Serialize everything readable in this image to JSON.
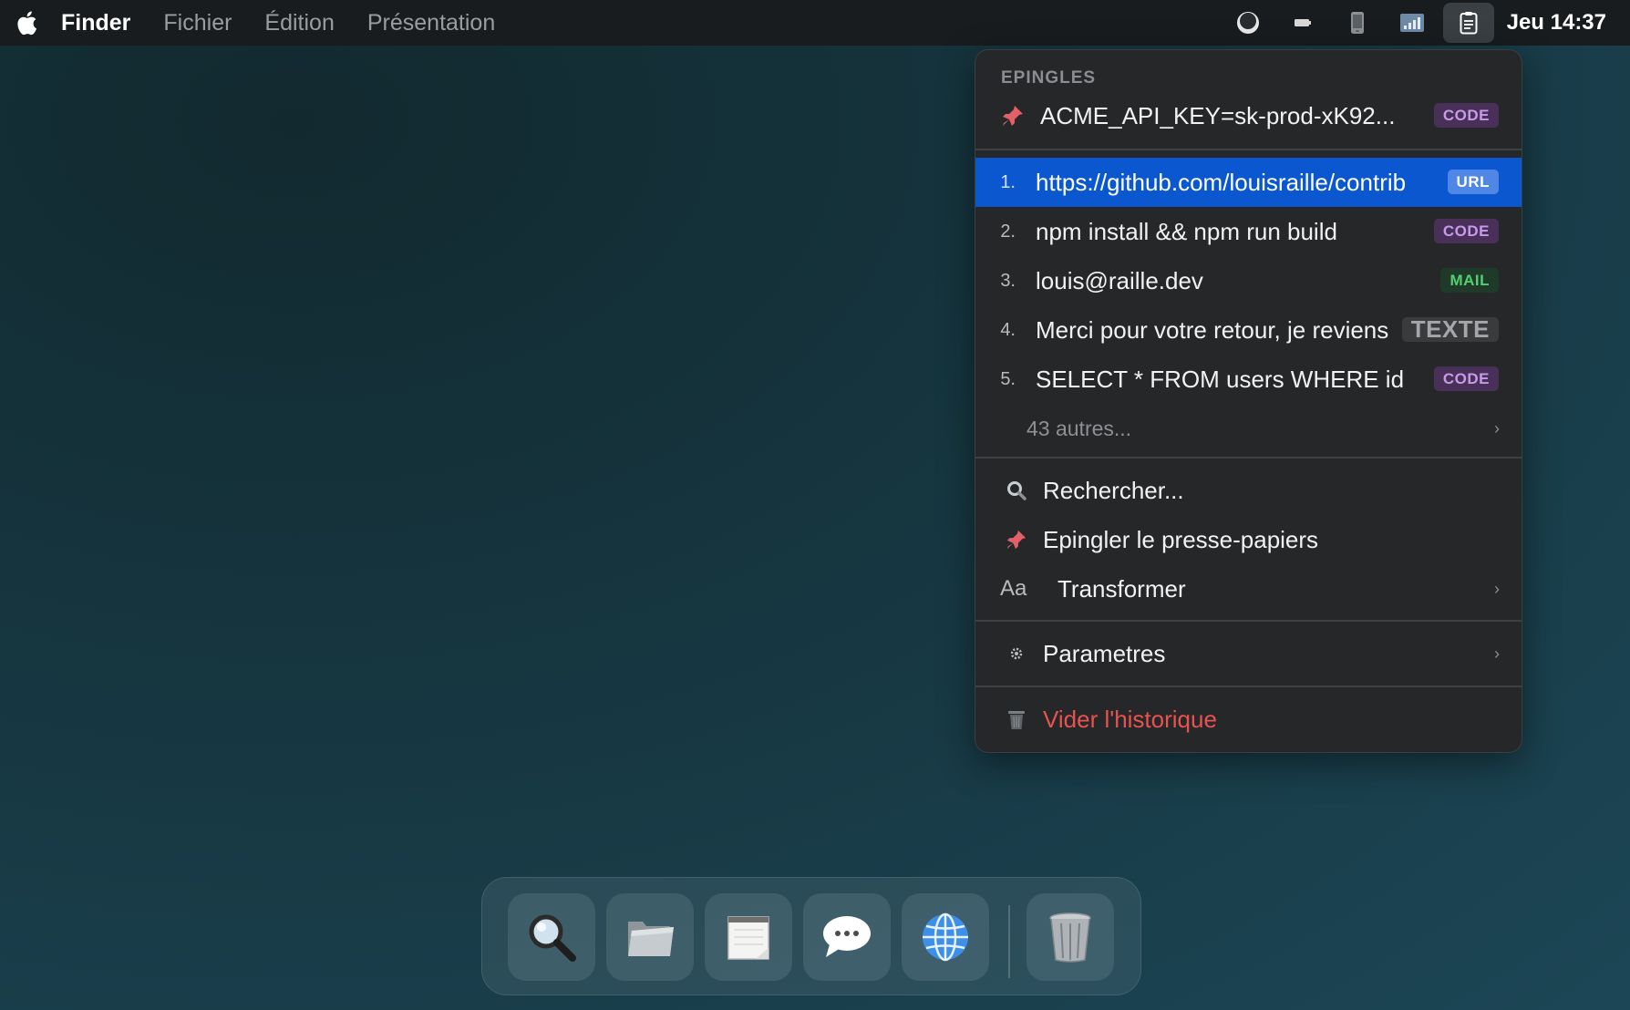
{
  "menubar": {
    "app_name": "Finder",
    "menus": [
      "Fichier",
      "Édition",
      "Présentation"
    ],
    "status_icons": [
      "circle-icon",
      "battery-icon",
      "phone-icon",
      "signal-icon",
      "clipboard-icon"
    ],
    "clock": "Jeu 14:37"
  },
  "panel": {
    "pinned_title": "EPINGLES",
    "pinned": {
      "text": "ACME_API_KEY=sk-prod-xK92...",
      "badge": "CODE"
    },
    "history": [
      {
        "num": "1.",
        "text": "https://github.com/louisraille/contrib",
        "badge": "URL",
        "selected": true
      },
      {
        "num": "2.",
        "text": "npm install && npm run build",
        "badge": "CODE"
      },
      {
        "num": "3.",
        "text": "louis@raille.dev",
        "badge": "MAIL"
      },
      {
        "num": "4.",
        "text": "Merci pour votre retour, je reviens",
        "badge": "TEXTE"
      },
      {
        "num": "5.",
        "text": "SELECT * FROM users WHERE id",
        "badge": "CODE"
      }
    ],
    "more": "43 autres...",
    "actions": {
      "search": "Rechercher...",
      "pin": "Epingler le presse-papiers",
      "transform_icon": "Aa",
      "transform": "Transformer",
      "settings": "Parametres",
      "clear": "Vider l'historique"
    },
    "chevron": "›"
  },
  "dock": {
    "items": [
      "magnifier-icon",
      "folder-icon",
      "notes-icon",
      "messages-icon",
      "globe-icon",
      "trash-icon"
    ]
  },
  "colors": {
    "selected": "#0b57d0",
    "danger": "#e8534f",
    "code_badge": "#c99aea",
    "mail_badge": "#52d071"
  }
}
